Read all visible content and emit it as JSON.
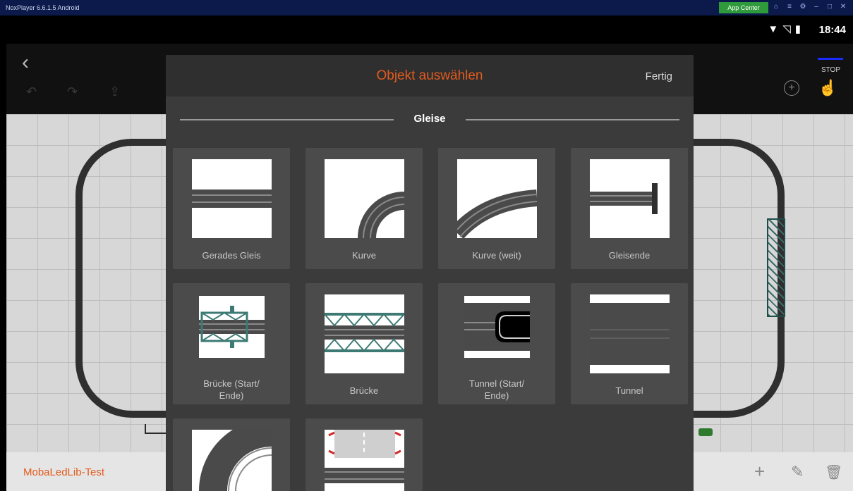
{
  "window": {
    "title": "NoxPlayer 6.6.1.5 Android",
    "app_center_label": "App Center",
    "controls": [
      "⌂",
      "≡",
      "⚙",
      "–",
      "□",
      "✕"
    ]
  },
  "status": {
    "time": "18:44",
    "icons": [
      "wifi-icon",
      "signal-icon",
      "battery-icon"
    ]
  },
  "toolbar": {
    "back": "‹",
    "stop_label": "STOP",
    "undo_icons": [
      "↶",
      "↷",
      "⇪"
    ]
  },
  "dialog": {
    "title": "Objekt auswählen",
    "done_label": "Fertig",
    "section_label": "Gleise",
    "tiles": [
      {
        "label": "Gerades Gleis",
        "icon": "straight-track-icon"
      },
      {
        "label": "Kurve",
        "icon": "curve-track-icon"
      },
      {
        "label": "Kurve (weit)",
        "icon": "wide-curve-track-icon"
      },
      {
        "label": "Gleisende",
        "icon": "track-end-icon"
      },
      {
        "label": "Brücke (Start/\nEnde)",
        "icon": "bridge-start-end-icon"
      },
      {
        "label": "Brücke",
        "icon": "bridge-icon"
      },
      {
        "label": "Tunnel (Start/\nEnde)",
        "icon": "tunnel-start-end-icon"
      },
      {
        "label": "Tunnel",
        "icon": "tunnel-icon"
      },
      {
        "label": "",
        "icon": "curve-double-track-icon"
      },
      {
        "label": "",
        "icon": "level-crossing-icon"
      }
    ]
  },
  "bottom": {
    "project_name": "MobaLedLib-Test",
    "icons": [
      "add-icon",
      "edit-icon",
      "delete-icon"
    ],
    "glyphs": [
      "+",
      "✎",
      "🗑"
    ]
  },
  "colors": {
    "accent": "#e35b1d",
    "dialog_bg": "#3b3b3b",
    "tile_bg": "#4b4b4b"
  }
}
